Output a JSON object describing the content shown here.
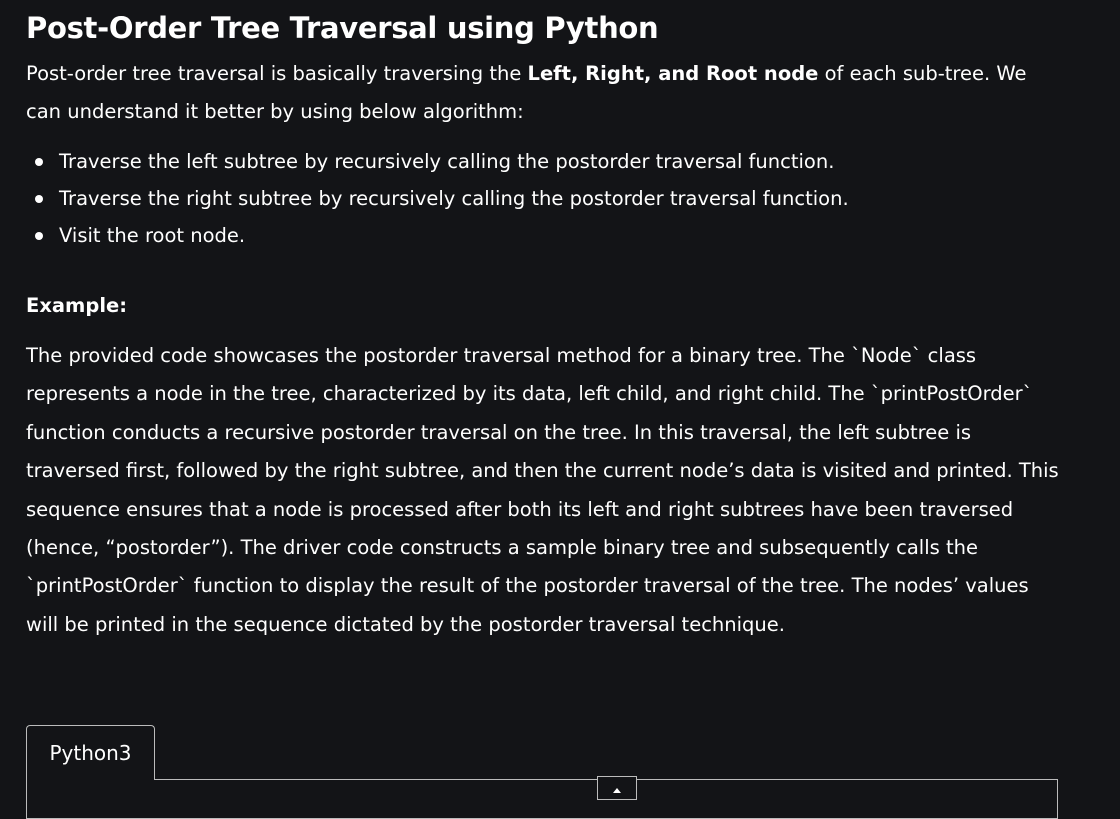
{
  "article": {
    "title": "Post-Order Tree Traversal using Python",
    "intro": {
      "before": "Post-order tree traversal is basically traversing the ",
      "bold": "Left, Right, and Root node",
      "after": " of each sub-tree. We can understand it better by using below algorithm:"
    },
    "steps": [
      "Traverse the left subtree by recursively calling the postorder traversal function.",
      "Traverse the right subtree by recursively calling the postorder traversal function.",
      "Visit the root node."
    ],
    "example_heading": "Example:",
    "example_body": "The provided code showcases the postorder traversal method for a binary tree. The `Node` class represents a node in the tree, characterized by its data, left child, and right child. The `printPostOrder` function conducts a recursive postorder traversal on the tree. In this traversal, the left subtree is traversed first, followed by the right subtree, and then the current node’s data is visited and printed. This sequence ensures that a node is processed after both its left and right subtrees have been traversed (hence, “postorder”). The driver code constructs a sample binary tree and subsequently calls the `printPostOrder` function to display the result of the postorder traversal of the tree. The nodes’ values will be printed in the sequence dictated by the postorder traversal technique."
  },
  "code_tabs": {
    "tabs": [
      "Python3"
    ]
  },
  "icons": {
    "scroll_handle": "chevron-up-icon"
  },
  "colors": {
    "background": "#131417",
    "text": "#ffffff",
    "border": "#bcbcbc"
  }
}
